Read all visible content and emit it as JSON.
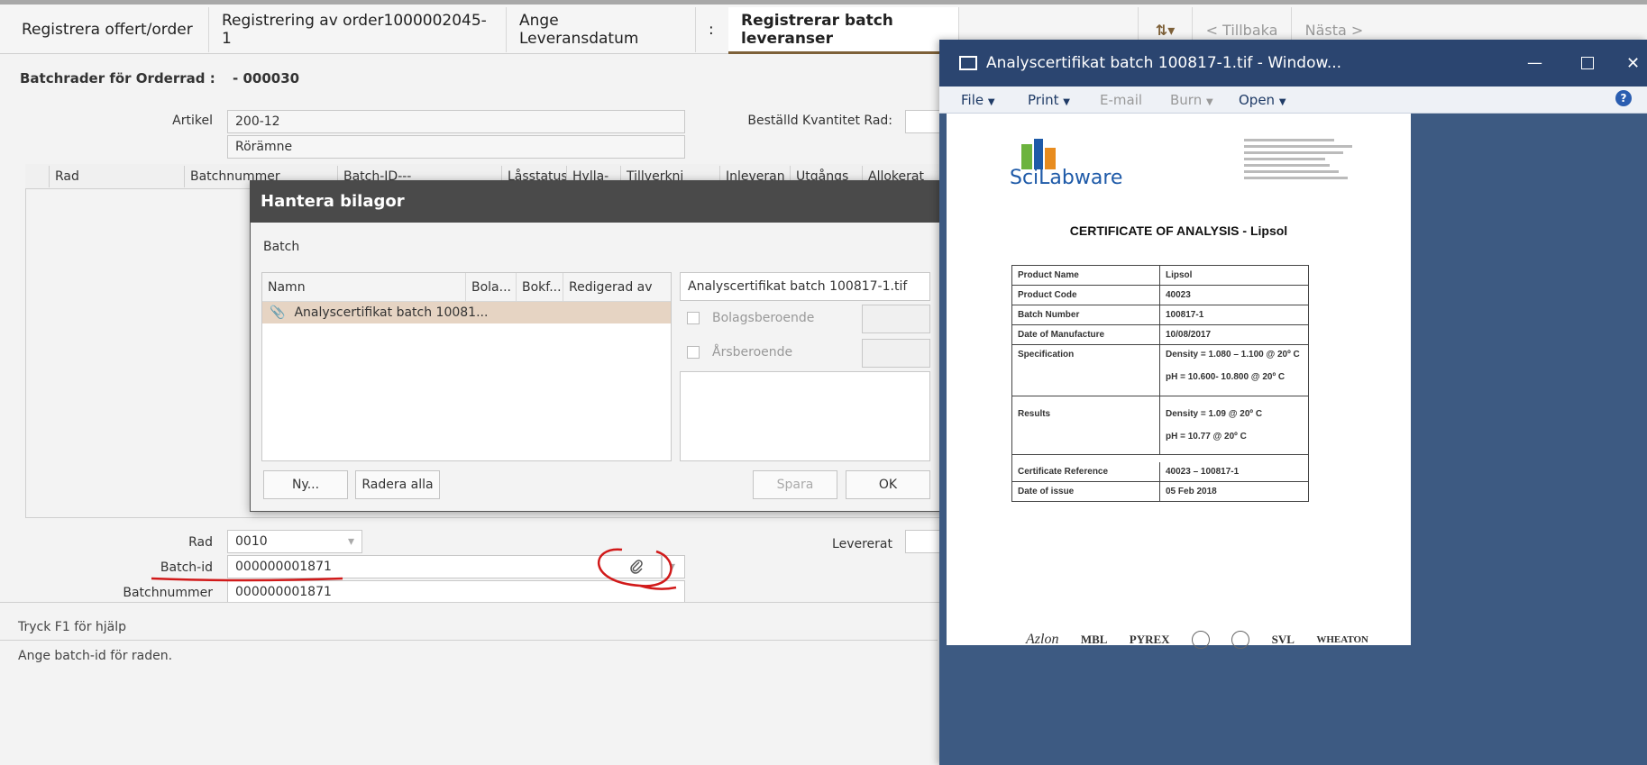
{
  "tabs": [
    {
      "label": "Registrera offert/order"
    },
    {
      "label": "Registrering av order1000002045-1"
    },
    {
      "label": "Ange Leveransdatum"
    },
    {
      "label": ":"
    },
    {
      "label": "Registrerar batch leveranser"
    }
  ],
  "nav": {
    "back": "< Tillbaka",
    "next": "Nästa >",
    "sort_icon": "sort-icon"
  },
  "header": {
    "label": "Batchrader för Orderrad :",
    "value": "- 000030"
  },
  "form": {
    "artikel_label": "Artikel",
    "artikel_value": "200-12",
    "artikel_desc": "Rörämne",
    "bestalld_label": "Beställd Kvantitet Rad:",
    "rad_label": "Rad",
    "rad_value": "0010",
    "levererat_label": "Levererat",
    "batchid_label": "Batch-id",
    "batchid_value": "000000001871",
    "batchnummer_label": "Batchnummer",
    "batchnummer_value": "000000001871"
  },
  "grid": {
    "columns": [
      "Rad",
      "Batchnummer",
      "Batch-ID---",
      "Låsstatus",
      "Hylla-",
      "Tillverkni",
      "Inleveran",
      "Utgångs",
      "Allokerat"
    ]
  },
  "status": {
    "help": "Tryck F1 för hjälp",
    "hint": "Ange batch-id för raden."
  },
  "dialog": {
    "title": "Hantera bilagor",
    "section": "Batch",
    "columns": [
      "Namn",
      "Bola...",
      "Bokf...",
      "Redigerad av"
    ],
    "rows": [
      {
        "name": "Analyscertifikat batch 10081..."
      }
    ],
    "selected_file": "Analyscertifikat batch 100817-1.tif",
    "check_bolag": "Bolagsberoende",
    "check_ar": "Årsberoende",
    "btn_new": "Ny...",
    "btn_delete_all": "Radera alla",
    "btn_save": "Spara",
    "btn_ok": "OK"
  },
  "viewer": {
    "title": "Analyscertifikat batch 100817-1.tif - Window...",
    "menu": [
      "File",
      "Print",
      "E-mail",
      "Burn",
      "Open"
    ],
    "doc": {
      "brand": "SciLabware",
      "heading": "CERTIFICATE OF ANALYSIS - Lipsol",
      "rows": [
        {
          "k": "Product Name",
          "v": "Lipsol"
        },
        {
          "k": "Product Code",
          "v": "40023"
        },
        {
          "k": "Batch Number",
          "v": "100817-1"
        },
        {
          "k": "Date of Manufacture",
          "v": "10/08/2017"
        },
        {
          "k": "Specification",
          "v": "Density = 1.080 – 1.100 @ 20º C",
          "v2": "pH = 10.600- 10.800 @ 20º C"
        },
        {
          "k": "Results",
          "v": "Density = 1.09 @ 20º C",
          "v2": "pH = 10.77 @ 20º C"
        },
        {
          "k": "Certificate Reference",
          "v": "40023 – 100817-1"
        },
        {
          "k": "Date of issue",
          "v": "05 Feb 2018"
        }
      ],
      "footer_brands": [
        "Azlon",
        "MBL",
        "PYREX",
        "SVL",
        "WHEATON"
      ]
    }
  },
  "colors": {
    "accent": "#7d6038",
    "dialog_title": "#4a4a4a",
    "viewer_title": "#2b4570",
    "annotation": "#d11a1a",
    "selected_row": "#e6d4c3"
  }
}
